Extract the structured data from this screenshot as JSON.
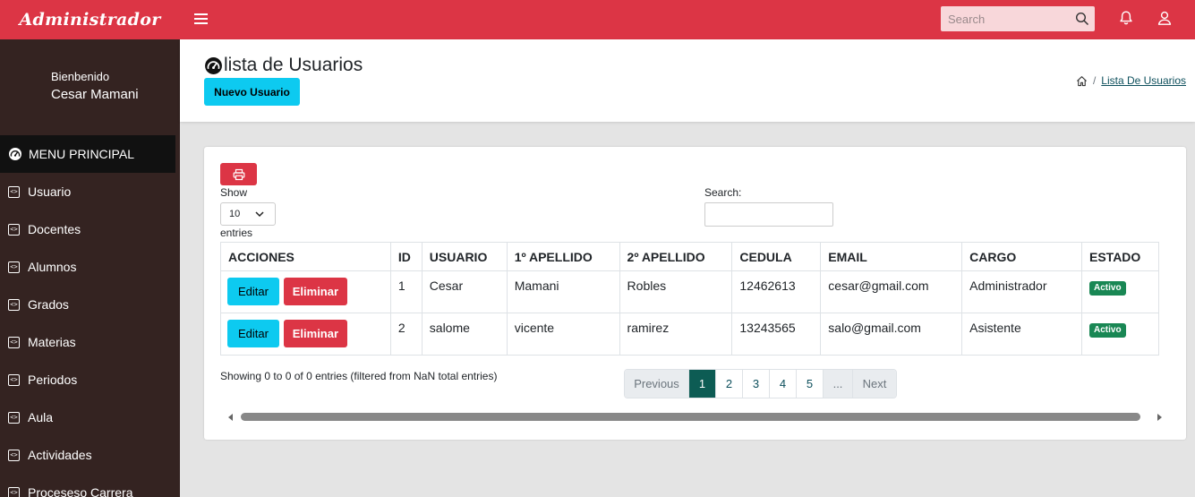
{
  "brand": {
    "title": "Administrador"
  },
  "topbar": {
    "search_placeholder": "Search",
    "icons": [
      "menu-icon",
      "search-icon",
      "bell-icon",
      "user-icon"
    ]
  },
  "sidebar": {
    "welcome": "Bienbenido",
    "user_name": "Cesar Mamani",
    "header": "MENU PRINCIPAL",
    "items": [
      {
        "label": "Usuario"
      },
      {
        "label": "Docentes"
      },
      {
        "label": "Alumnos"
      },
      {
        "label": "Grados"
      },
      {
        "label": "Materias"
      },
      {
        "label": "Periodos"
      },
      {
        "label": "Aula"
      },
      {
        "label": "Actividades"
      },
      {
        "label": "Proceseso Carrera"
      }
    ]
  },
  "header": {
    "title": "lista de Usuarios",
    "new_button": "Nuevo Usuario",
    "breadcrumb_link": "Lista De Usuarios"
  },
  "table_controls": {
    "show_label": "Show",
    "length_value": "10",
    "entries_label": "entries",
    "search_label": "Search:",
    "search_value": ""
  },
  "table": {
    "columns": [
      "ACCIONES",
      "ID",
      "USUARIO",
      "1º APELLIDO",
      "2º APELLIDO",
      "CEDULA",
      "EMAIL",
      "CARGO",
      "ESTADO"
    ],
    "edit_label": "Editar",
    "delete_label": "Eliminar",
    "rows": [
      {
        "id": "1",
        "usuario": "Cesar",
        "apellido1": "Mamani",
        "apellido2": "Robles",
        "cedula": "12462613",
        "email": "cesar@gmail.com",
        "cargo": "Administrador",
        "estado": "Activo"
      },
      {
        "id": "2",
        "usuario": "salome",
        "apellido1": "vicente",
        "apellido2": "ramirez",
        "cedula": "13243565",
        "email": "salo@gmail.com",
        "cargo": "Asistente",
        "estado": "Activo"
      }
    ]
  },
  "footer": {
    "info": "Showing 0 to 0 of 0 entries (filtered from NaN total entries)",
    "pagination": {
      "previous": "Previous",
      "pages": [
        "1",
        "2",
        "3",
        "4",
        "5"
      ],
      "ellipsis": "...",
      "next": "Next",
      "current": "1"
    }
  },
  "colors": {
    "accent_red": "#dc3545",
    "sidebar_bg": "#342321",
    "info_cyan": "#0dcaf0",
    "success_green": "#198754",
    "page_active": "#0d5c54"
  }
}
